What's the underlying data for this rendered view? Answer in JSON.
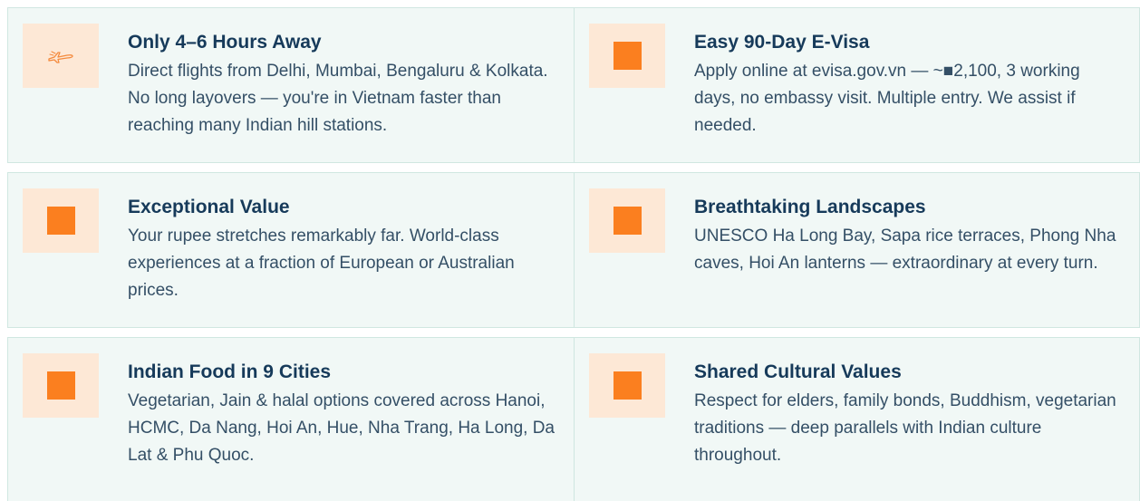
{
  "features": [
    {
      "title": "Only 4–6 Hours Away",
      "description": "Direct flights from Delhi, Mumbai, Bengaluru & Kolkata. No long layovers — you're in Vietnam faster than reaching many Indian hill stations.",
      "icon": "airplane-icon"
    },
    {
      "title": "Easy 90-Day E-Visa",
      "description": "Apply online at evisa.gov.vn — ~■2,100, 3 working days, no embassy visit. Multiple entry. We assist if needed.",
      "icon": "square-icon"
    },
    {
      "title": "Exceptional Value",
      "description": "Your rupee stretches remarkably far. World-class experiences at a fraction of European or Australian prices.",
      "icon": "square-icon"
    },
    {
      "title": "Breathtaking Landscapes",
      "description": "UNESCO Ha Long Bay, Sapa rice terraces, Phong Nha caves, Hoi An lanterns — extraordinary at every turn.",
      "icon": "square-icon"
    },
    {
      "title": "Indian Food in 9 Cities",
      "description": "Vegetarian, Jain & halal options covered across Hanoi, HCMC, Da Nang, Hoi An, Hue, Nha Trang, Ha Long, Da Lat & Phu Quoc.",
      "icon": "square-icon"
    },
    {
      "title": "Shared Cultural Values",
      "description": "Respect for elders, family bonds, Buddhism, vegetarian traditions — deep parallels with Indian culture throughout.",
      "icon": "square-icon"
    }
  ],
  "colors": {
    "card_background": "#f1f8f6",
    "card_border": "#d0e7e1",
    "icon_background": "#fde8d6",
    "accent": "#fb7f1f",
    "title": "#163a5a",
    "text": "#344f66"
  }
}
